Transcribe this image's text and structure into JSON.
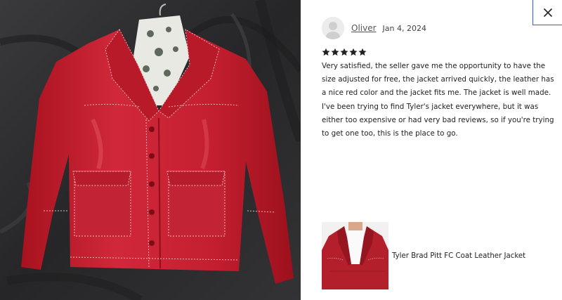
{
  "photo": {
    "subject": "red leather jacket on hanger",
    "colors": {
      "background": "#2b2b2d",
      "jacket": "#c91f2e",
      "stitching": "#e8b7b5"
    }
  },
  "header": {
    "close_icon": "close-icon",
    "accent": "#2f5fd0"
  },
  "review": {
    "reviewer_name": "Oliver",
    "date": "Jan 4, 2024",
    "rating": 5,
    "text": "Very satisfied, the seller gave me the opportunity to have the size adjusted for free, the jacket arrived quickly, the leather has a nice red color and the jacket fits me. The jacket is well made. I've been trying to find Tyler's jacket everywhere, but it was either too expensive or had very bad reviews, so if you're trying to get one too, this is the place to go."
  },
  "product": {
    "title": "Tyler Brad Pitt FC Coat Leather Jacket"
  }
}
